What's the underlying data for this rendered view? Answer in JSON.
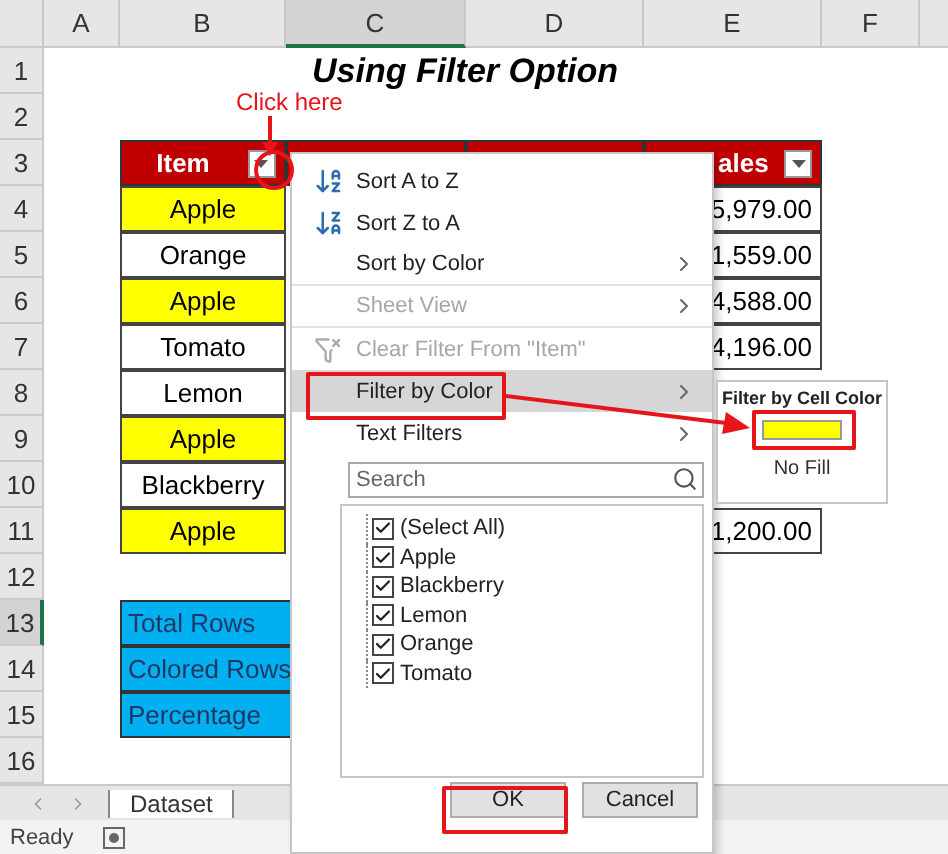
{
  "columns": [
    {
      "label": "A",
      "selected": false
    },
    {
      "label": "B",
      "selected": false
    },
    {
      "label": "C",
      "selected": true
    },
    {
      "label": "D",
      "selected": false
    },
    {
      "label": "E",
      "selected": false
    },
    {
      "label": "F",
      "selected": false
    }
  ],
  "row_numbers": [
    {
      "label": "1",
      "selected": false
    },
    {
      "label": "2",
      "selected": false
    },
    {
      "label": "3",
      "selected": false
    },
    {
      "label": "4",
      "selected": false
    },
    {
      "label": "5",
      "selected": false
    },
    {
      "label": "6",
      "selected": false
    },
    {
      "label": "7",
      "selected": false
    },
    {
      "label": "8",
      "selected": false
    },
    {
      "label": "9",
      "selected": false
    },
    {
      "label": "10",
      "selected": false
    },
    {
      "label": "11",
      "selected": false
    },
    {
      "label": "12",
      "selected": false
    },
    {
      "label": "13",
      "selected": true
    },
    {
      "label": "14",
      "selected": false
    },
    {
      "label": "15",
      "selected": false
    },
    {
      "label": "16",
      "selected": false
    }
  ],
  "title": "Using Filter Option",
  "callout": "Click here",
  "table": {
    "header": {
      "item": "Item",
      "sales": "ales"
    },
    "rows": [
      {
        "item": "Apple",
        "color": "#ffff00",
        "sales": "5,979.00"
      },
      {
        "item": "Orange",
        "color": "#ffffff",
        "sales": "1,559.00"
      },
      {
        "item": "Apple",
        "color": "#ffff00",
        "sales": "4,588.00"
      },
      {
        "item": "Tomato",
        "color": "#ffffff",
        "sales": "4,196.00"
      },
      {
        "item": "Lemon",
        "color": "#ffffff"
      },
      {
        "item": "Apple",
        "color": "#ffff00"
      },
      {
        "item": "Blackberry",
        "color": "#ffffff"
      },
      {
        "item": "Apple",
        "color": "#ffff00",
        "sales": "1,200.00"
      }
    ]
  },
  "summary": [
    "Total Rows",
    "Colored Rows",
    "Percentage"
  ],
  "filter_menu": {
    "items": [
      {
        "label": "Sort A to Z",
        "kind": "sort-asc",
        "disabled": false,
        "submenu": false,
        "selected": false
      },
      {
        "label": "Sort Z to A",
        "kind": "sort-desc",
        "disabled": false,
        "submenu": false,
        "selected": false
      },
      {
        "label": "Sort by Color",
        "kind": "plain",
        "disabled": false,
        "submenu": true,
        "selected": false
      },
      {
        "label": "Sheet View",
        "kind": "plain",
        "disabled": true,
        "submenu": true,
        "selected": false
      },
      {
        "label": "Clear Filter From \"Item\"",
        "kind": "clear",
        "disabled": true,
        "submenu": false,
        "selected": false
      },
      {
        "label": "Filter by Color",
        "kind": "plain",
        "disabled": false,
        "submenu": true,
        "selected": true
      },
      {
        "label": "Text Filters",
        "kind": "plain",
        "disabled": false,
        "submenu": true,
        "selected": false
      }
    ],
    "search": {
      "placeholder": "Search"
    },
    "values": [
      {
        "label": "(Select All)",
        "checked": true
      },
      {
        "label": "Apple",
        "checked": true
      },
      {
        "label": "Blackberry",
        "checked": true
      },
      {
        "label": "Lemon",
        "checked": true
      },
      {
        "label": "Orange",
        "checked": true
      },
      {
        "label": "Tomato",
        "checked": true
      }
    ],
    "buttons": [
      "OK",
      "Cancel"
    ]
  },
  "color_submenu": {
    "title": "Filter by Cell Color",
    "swatch": {
      "color": "#ffff00"
    },
    "no_fill": "No Fill"
  },
  "sheet_tabs": [
    {
      "label": "Dataset",
      "selected": true
    }
  ],
  "status": "Ready"
}
